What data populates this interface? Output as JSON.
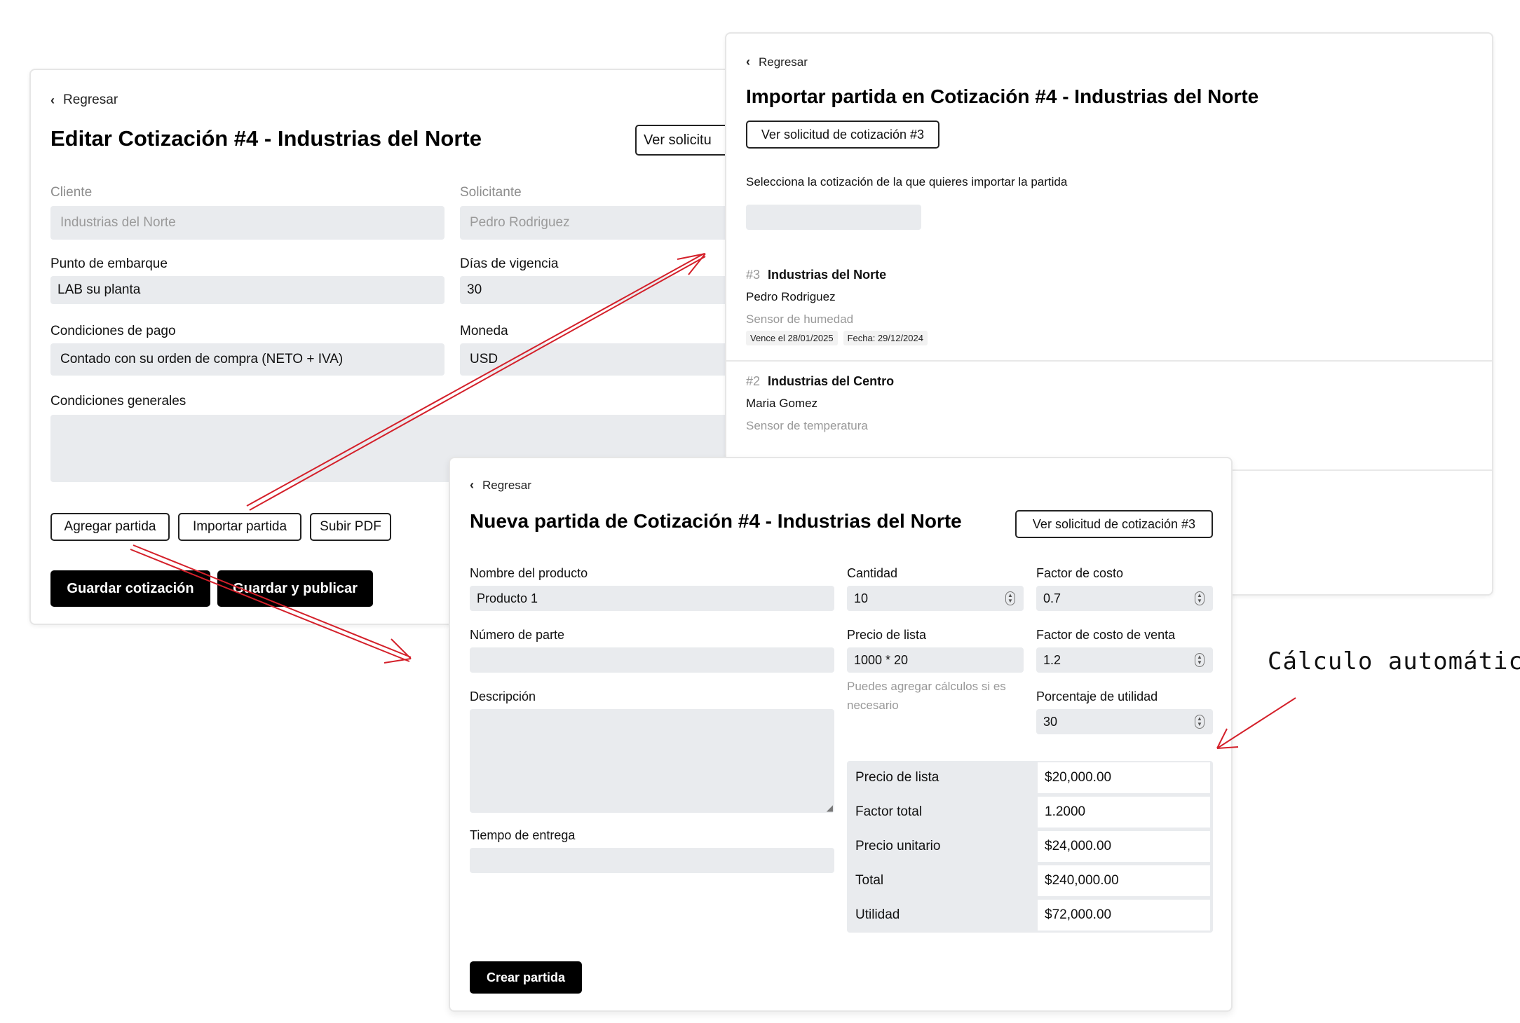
{
  "edit": {
    "back": "Regresar",
    "title": "Editar Cotización #4 - Industrias del Norte",
    "view_request": "Ver solicitu",
    "cliente_label": "Cliente",
    "cliente_value": "Industrias del Norte",
    "solicitante_label": "Solicitante",
    "solicitante_value": "Pedro Rodriguez",
    "embarque_label": "Punto de embarque",
    "embarque_value": "LAB su planta",
    "vigencia_label": "Días de vigencia",
    "vigencia_value": "30",
    "pago_label": "Condiciones de pago",
    "pago_value": "Contado con su orden de compra (NETO + IVA)",
    "moneda_label": "Moneda",
    "moneda_value": "USD",
    "generales_label": "Condiciones generales",
    "btn_agregar": "Agregar partida",
    "btn_importar": "Importar partida",
    "btn_pdf": "Subir PDF",
    "btn_guardar": "Guardar cotización",
    "btn_publicar": "Guardar y publicar"
  },
  "import": {
    "back": "Regresar",
    "title": "Importar partida en Cotización #4 - Industrias del Norte",
    "view_request": "Ver solicitud de cotización #3",
    "prompt": "Selecciona la cotización de la que quieres importar la partida",
    "quotes": [
      {
        "num": "#3",
        "client": "Industrias del Norte",
        "contact": "Pedro Rodriguez",
        "product": "Sensor de humedad",
        "expires": "Vence el 28/01/2025",
        "date": "Fecha: 29/12/2024"
      },
      {
        "num": "#2",
        "client": "Industrias del Centro",
        "contact": "Maria Gomez",
        "product": "Sensor de temperatura"
      }
    ]
  },
  "new": {
    "back": "Regresar",
    "title": "Nueva partida de Cotización #4 - Industrias del Norte",
    "view_request": "Ver solicitud de cotización #3",
    "producto_label": "Nombre del producto",
    "producto_value": "Producto 1",
    "parte_label": "Número de parte",
    "descripcion_label": "Descripción",
    "entrega_label": "Tiempo de entrega",
    "cantidad_label": "Cantidad",
    "cantidad_value": "10",
    "factor_costo_label": "Factor de costo",
    "factor_costo_value": "0.7",
    "precio_lista_label": "Precio de lista",
    "precio_lista_value": "1000 * 20",
    "factor_venta_label": "Factor de costo de venta",
    "factor_venta_value": "1.2",
    "hint": "Puedes agregar cálculos si es necesario",
    "utilidad_label": "Porcentaje de utilidad",
    "utilidad_value": "30",
    "summary": [
      {
        "k": "Precio de lista",
        "v": "$20,000.00"
      },
      {
        "k": "Factor total",
        "v": "1.2000"
      },
      {
        "k": "Precio unitario",
        "v": "$24,000.00"
      },
      {
        "k": "Total",
        "v": "$240,000.00"
      },
      {
        "k": "Utilidad",
        "v": "$72,000.00"
      }
    ],
    "btn_crear": "Crear partida"
  },
  "annotation": "Cálculo automático",
  "colors": {
    "arrow": "#d4202a",
    "field_bg": "#e9ebee",
    "button_dark": "#000000"
  }
}
